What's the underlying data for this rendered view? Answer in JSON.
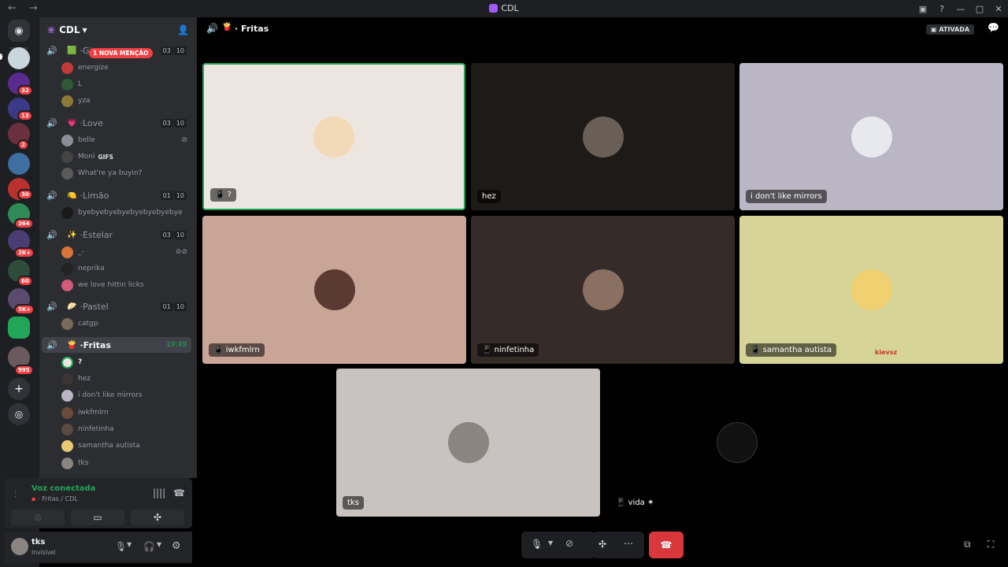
{
  "window": {
    "title": "CDL",
    "nav": "← →"
  },
  "servers": {
    "badges": [
      "32",
      "13",
      "2",
      "30",
      "364",
      "2K+",
      "60",
      "5K+",
      "995"
    ]
  },
  "guild": {
    "name": "CDL",
    "mention": "1 NOVA MENÇÃO"
  },
  "channels": [
    {
      "emoji": "🟩",
      "name": "Gi",
      "counts": [
        "03",
        "10"
      ],
      "members": [
        "energize",
        "L",
        "yza"
      ]
    },
    {
      "emoji": "💗",
      "name": "Love",
      "counts": [
        "03",
        "10"
      ],
      "members": [
        "belle",
        "Moni",
        "What're ya buyin?"
      ]
    },
    {
      "emoji": "🍋",
      "name": "Limão",
      "counts": [
        "01",
        "10"
      ],
      "members": [
        "byebyebyebyebyebyebyebye"
      ]
    },
    {
      "emoji": "✨",
      "name": "Estelar",
      "counts": [
        "03",
        "10"
      ],
      "members": [
        "_-",
        "neprika",
        "we love hittin licks"
      ]
    },
    {
      "emoji": "🥟",
      "name": "Pastel",
      "counts": [
        "01",
        "10"
      ],
      "members": [
        "catgp"
      ]
    },
    {
      "emoji": "🍟",
      "name": "Fritas",
      "time": "19:49",
      "members": [
        "?",
        "hez",
        "i don't like mirrors",
        "iwkfmlrn",
        "ninfetinha",
        "samantha autista",
        "tks"
      ]
    }
  ],
  "moni_tag": "GIFS",
  "voice": {
    "status": "Voz conectada",
    "location": "Fritas / CDL"
  },
  "user": {
    "name": "tks",
    "status": "Invisível"
  },
  "call": {
    "channel": "Fritas",
    "activity_badge": "ATIVADA"
  },
  "tiles": [
    {
      "name": "?",
      "bg": "#ede5df",
      "mobile": true
    },
    {
      "name": "hez",
      "bg": "#1d1a17",
      "mobile": false
    },
    {
      "name": "i don't like mirrors",
      "bg": "#bab6c4",
      "mobile": false
    },
    {
      "name": "iwkfmlrn",
      "bg": "#c8a597",
      "mobile": true
    },
    {
      "name": "ninfetinha",
      "bg": "#352b29",
      "mobile": true
    },
    {
      "name": "samantha autista",
      "bg": "#d6d497",
      "mobile": true,
      "extra": "kievsz"
    },
    {
      "name": "tks",
      "bg": "#c8c2c0",
      "mobile": false
    },
    {
      "name": "vida ✶",
      "bg": "#000000",
      "mobile": true
    }
  ],
  "colors": {
    "green": "#23a559",
    "red": "#da373c",
    "blurple": "#5865f2"
  }
}
